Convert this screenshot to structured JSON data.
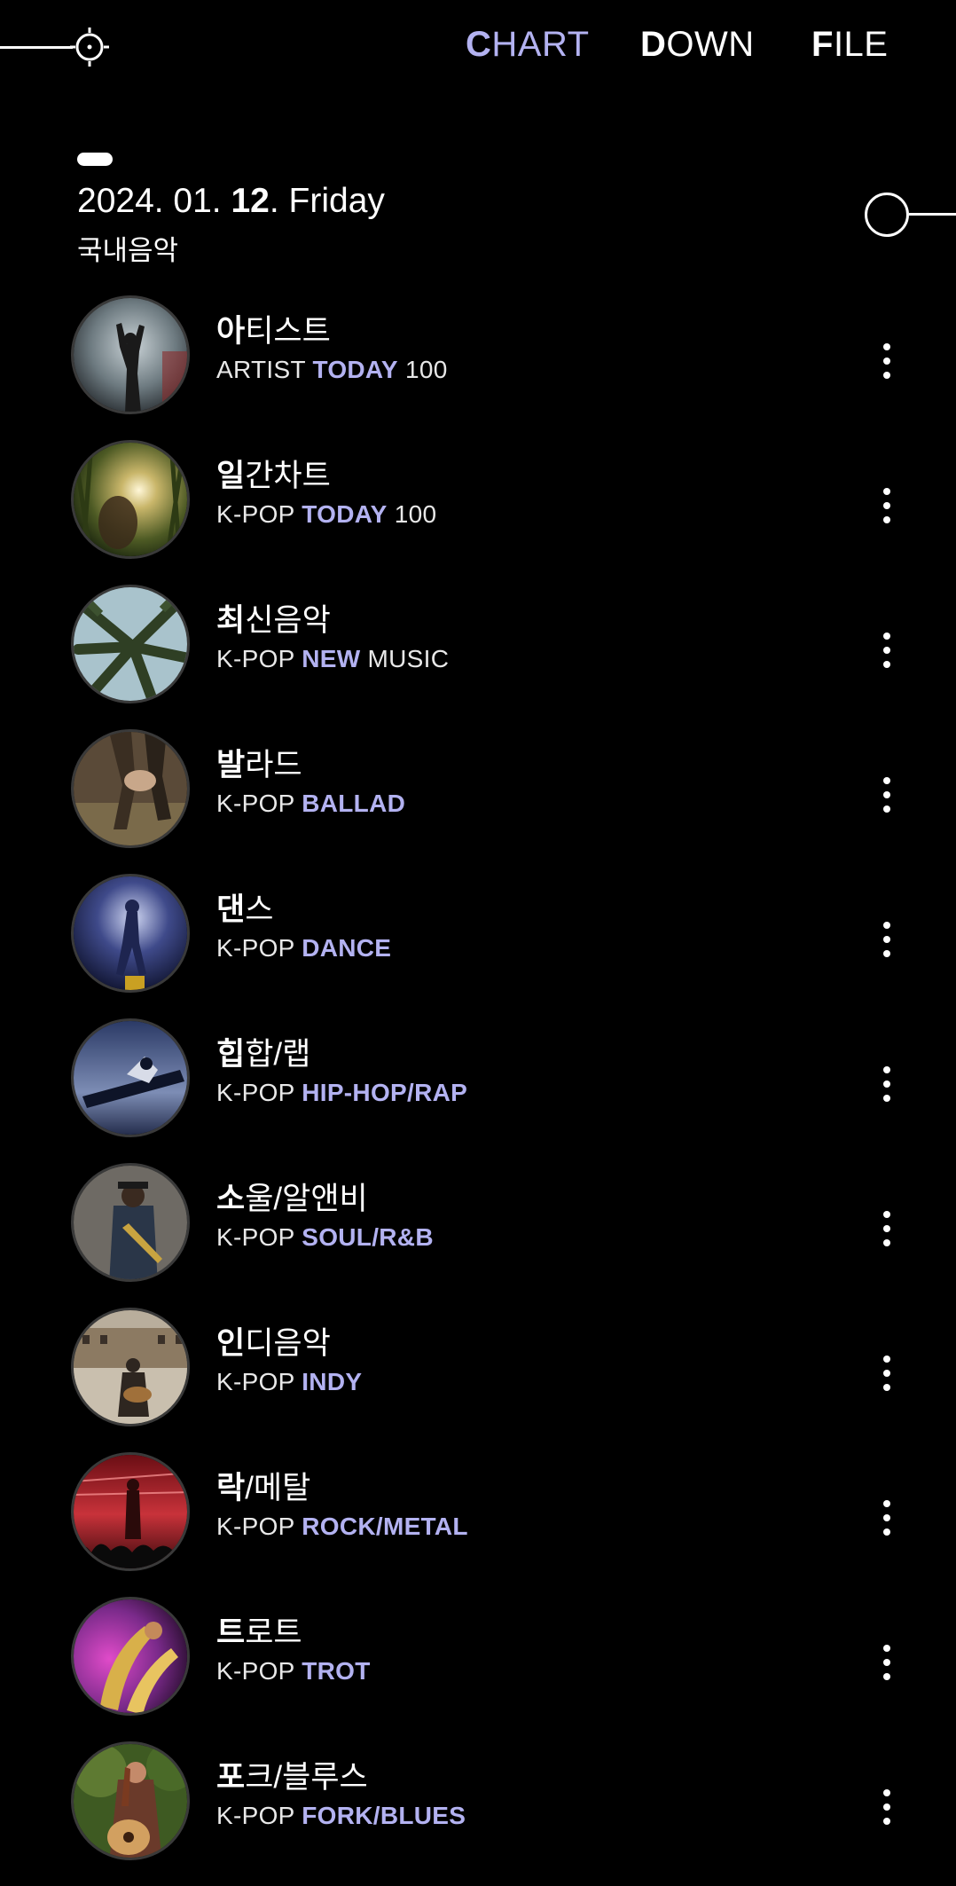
{
  "header": {
    "nav": [
      {
        "first": "C",
        "rest": "HART",
        "active": true
      },
      {
        "first": "D",
        "rest": "OWN",
        "active": false
      },
      {
        "first": "F",
        "rest": "ILE",
        "active": false
      }
    ]
  },
  "date": {
    "prefix": "2024. 01. ",
    "day": "12",
    "suffix": ". Friday"
  },
  "category": "국내음악",
  "colors": {
    "accent": "#b3b2f1",
    "background": "#000000"
  },
  "items": [
    {
      "title_bold": "아",
      "title_rest": "티스트",
      "desc_pre": "ARTIST ",
      "desc_hl": "TODAY",
      "desc_post": " 100",
      "thumb": "concert-singer"
    },
    {
      "title_bold": "일",
      "title_rest": "간차트",
      "desc_pre": "K-POP ",
      "desc_hl": "TODAY",
      "desc_post": " 100",
      "thumb": "forest-sun"
    },
    {
      "title_bold": "최",
      "title_rest": "신음악",
      "desc_pre": "K-POP ",
      "desc_hl": "NEW",
      "desc_post": " MUSIC",
      "thumb": "palm-trees"
    },
    {
      "title_bold": "발",
      "title_rest": "라드",
      "desc_pre": "K-POP ",
      "desc_hl": "BALLAD",
      "desc_post": "",
      "thumb": "couple-field"
    },
    {
      "title_bold": "댄",
      "title_rest": "스",
      "desc_pre": "K-POP ",
      "desc_hl": "DANCE",
      "desc_post": "",
      "thumb": "dancer-street"
    },
    {
      "title_bold": "힙",
      "title_rest": "합/랩",
      "desc_pre": "K-POP ",
      "desc_hl": "HIP-HOP/RAP",
      "desc_post": "",
      "thumb": "breakdancer"
    },
    {
      "title_bold": "소",
      "title_rest": "울/알앤비",
      "desc_pre": "K-POP ",
      "desc_hl": "SOUL/R&B",
      "desc_post": "",
      "thumb": "trumpet-player"
    },
    {
      "title_bold": "인",
      "title_rest": "디음악",
      "desc_pre": "K-POP ",
      "desc_hl": "INDY",
      "desc_post": "",
      "thumb": "street-guitarist"
    },
    {
      "title_bold": "락",
      "title_rest": "/메탈",
      "desc_pre": "K-POP ",
      "desc_hl": "ROCK/METAL",
      "desc_post": "",
      "thumb": "rock-stage"
    },
    {
      "title_bold": "트",
      "title_rest": "로트",
      "desc_pre": "K-POP ",
      "desc_hl": "TROT",
      "desc_post": "",
      "thumb": "saxophone"
    },
    {
      "title_bold": "포",
      "title_rest": "크/블루스",
      "desc_pre": "K-POP ",
      "desc_hl": "FORK/BLUES",
      "desc_post": "",
      "thumb": "acoustic-guitar-girl"
    }
  ]
}
